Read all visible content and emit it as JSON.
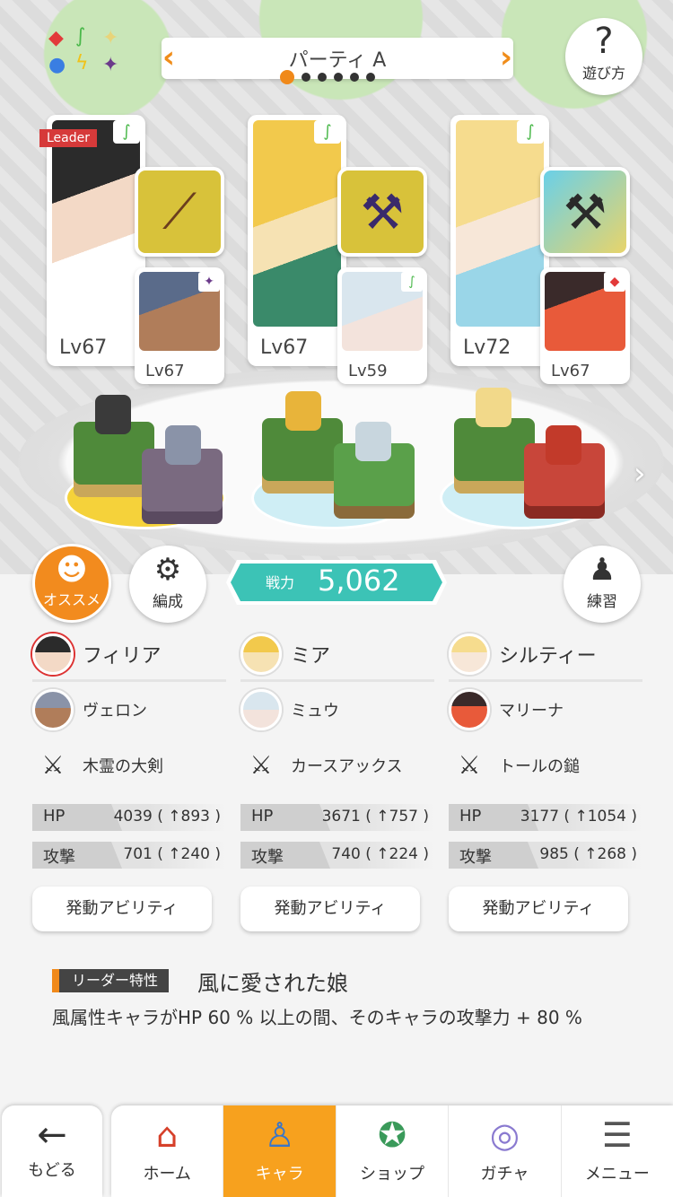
{
  "header": {
    "party_title": "パーティ A",
    "help_label": "遊び方",
    "page_count": 6,
    "active_page_index": 0
  },
  "leader_badge": "Leader",
  "cards": [
    {
      "main_level": "Lv67",
      "sub_level": "Lv67",
      "main_element": "wind-icon",
      "sub_element": "dark-star-icon",
      "weapon_icon": "greatsword-icon"
    },
    {
      "main_level": "Lv67",
      "sub_level": "Lv59",
      "main_element": "wind-icon",
      "sub_element": "wind-icon",
      "weapon_icon": "axe-icon"
    },
    {
      "main_level": "Lv72",
      "sub_level": "Lv67",
      "main_element": "wind-icon",
      "sub_element": "fire-diamond-icon",
      "weapon_icon": "hammer-icon"
    }
  ],
  "controls": {
    "recommend_label": "オススメ",
    "formation_label": "編成",
    "practice_label": "練習",
    "power_label": "戦力",
    "power_value": "5,062"
  },
  "team": [
    {
      "main_name": "フィリア",
      "sub_name": "ヴェロン",
      "weapon_name": "木霊の大剣",
      "hp_label": "HP",
      "hp_value": "4039 ( ↑893 )",
      "atk_label": "攻撃",
      "atk_value": "701 ( ↑240 )",
      "ability_label": "発動アビリティ"
    },
    {
      "main_name": "ミア",
      "sub_name": "ミュウ",
      "weapon_name": "カースアックス",
      "hp_label": "HP",
      "hp_value": "3671 ( ↑757 )",
      "atk_label": "攻撃",
      "atk_value": "740 ( ↑224 )",
      "ability_label": "発動アビリティ"
    },
    {
      "main_name": "シルティー",
      "sub_name": "マリーナ",
      "weapon_name": "トールの鎚",
      "hp_label": "HP",
      "hp_value": "3177 ( ↑1054 )",
      "atk_label": "攻撃",
      "atk_value": "985 ( ↑268 )",
      "ability_label": "発動アビリティ"
    }
  ],
  "leader_trait": {
    "tag": "リーダー特性",
    "name": "風に愛された娘",
    "description": "風属性キャラがHP 60 % 以上の間、そのキャラの攻撃力 + 80 %"
  },
  "nav": {
    "back_label": "もどる",
    "tabs": [
      {
        "label": "ホーム",
        "icon": "home-icon"
      },
      {
        "label": "キャラ",
        "icon": "character-icon"
      },
      {
        "label": "ショップ",
        "icon": "shop-icon"
      },
      {
        "label": "ガチャ",
        "icon": "gacha-icon"
      },
      {
        "label": "メニュー",
        "icon": "menu-icon"
      }
    ],
    "active_tab": "キャラ"
  },
  "colors": {
    "accent_orange": "#f28b1e",
    "power_teal": "#3cc3b6",
    "leader_red": "#d63a3a",
    "wind_green": "#4ab84a"
  }
}
